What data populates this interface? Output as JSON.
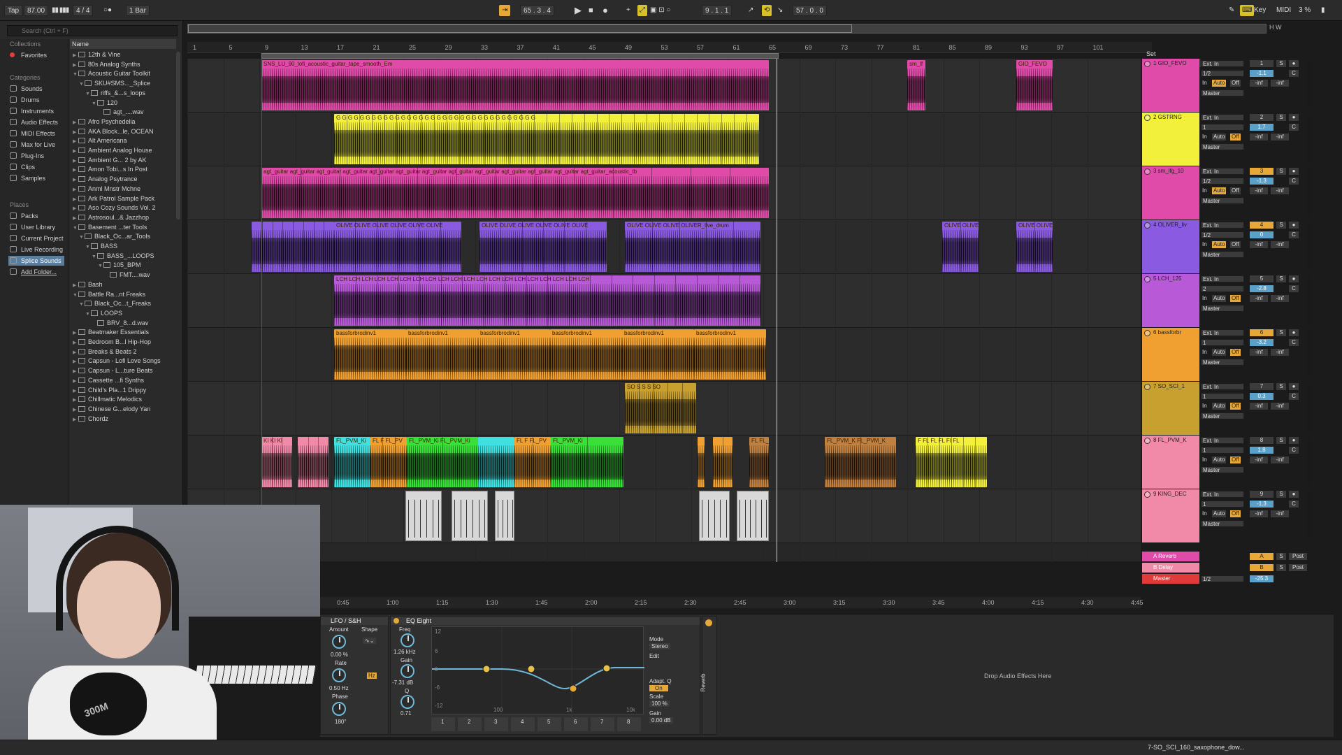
{
  "transport": {
    "tap": "Tap",
    "tempo": "87.00",
    "signature": "4 / 4",
    "quantize": "1 Bar",
    "position": "65 . 3 . 4",
    "loop_start": "9 . 1 . 1",
    "loop_length": "57 . 0 . 0",
    "key": "Key",
    "midi": "MIDI",
    "cpu": "3 %"
  },
  "browser": {
    "search_placeholder": "Search (Ctrl + F)",
    "collections_head": "Collections",
    "favorites": "Favorites",
    "categories_head": "Categories",
    "categories": [
      "Sounds",
      "Drums",
      "Instruments",
      "Audio Effects",
      "MIDI Effects",
      "Max for Live",
      "Plug-Ins",
      "Clips",
      "Samples"
    ],
    "places_head": "Places",
    "places": [
      "Packs",
      "User Library",
      "Current Project",
      "Live Recording",
      "Splice Sounds",
      "Add Folder..."
    ],
    "name_head": "Name",
    "rows": [
      {
        "label": "12th & Vine",
        "indent": 0,
        "tri": "▶"
      },
      {
        "label": "80s Analog Synths",
        "indent": 0,
        "tri": "▶"
      },
      {
        "label": "Acoustic Guitar Toolkit",
        "indent": 0,
        "tri": "▼"
      },
      {
        "label": "SKU#SMS..._Splice",
        "indent": 1,
        "tri": "▼"
      },
      {
        "label": "riffs_&...s_loops",
        "indent": 2,
        "tri": "▼"
      },
      {
        "label": "120",
        "indent": 3,
        "tri": "▼"
      },
      {
        "label": "agt_....wav",
        "indent": 4,
        "tri": ""
      },
      {
        "label": "Afro Psychedelia",
        "indent": 0,
        "tri": "▶"
      },
      {
        "label": "AKA Block...le, OCEAN",
        "indent": 0,
        "tri": "▶"
      },
      {
        "label": "Alt Americana",
        "indent": 0,
        "tri": "▶"
      },
      {
        "label": "Ambient Analog House",
        "indent": 0,
        "tri": "▶"
      },
      {
        "label": "Ambient G... 2 by AK",
        "indent": 0,
        "tri": "▶"
      },
      {
        "label": "Amon Tobi...s In Post",
        "indent": 0,
        "tri": "▶"
      },
      {
        "label": "Analog Psytrance",
        "indent": 0,
        "tri": "▶"
      },
      {
        "label": "Anml Mnstr Mchne",
        "indent": 0,
        "tri": "▶"
      },
      {
        "label": "Ark Patrol Sample Pack",
        "indent": 0,
        "tri": "▶"
      },
      {
        "label": "Aso Cozy Sounds Vol. 2",
        "indent": 0,
        "tri": "▶"
      },
      {
        "label": "Astrosoul...& Jazzhop",
        "indent": 0,
        "tri": "▶"
      },
      {
        "label": "Basement ...ter Tools",
        "indent": 0,
        "tri": "▼"
      },
      {
        "label": "Black_Oc...ar_Tools",
        "indent": 1,
        "tri": "▼"
      },
      {
        "label": "BASS",
        "indent": 2,
        "tri": "▼"
      },
      {
        "label": "BASS_...LOOPS",
        "indent": 3,
        "tri": "▼"
      },
      {
        "label": "105_BPM",
        "indent": 4,
        "tri": "▼"
      },
      {
        "label": "FMT....wav",
        "indent": 5,
        "tri": ""
      },
      {
        "label": "Bash",
        "indent": 0,
        "tri": "▶"
      },
      {
        "label": "Battle Ra...nt Freaks",
        "indent": 0,
        "tri": "▼"
      },
      {
        "label": "Black_Oc...t_Freaks",
        "indent": 1,
        "tri": "▼"
      },
      {
        "label": "LOOPS",
        "indent": 2,
        "tri": "▼"
      },
      {
        "label": "BRV_8...d.wav",
        "indent": 3,
        "tri": ""
      },
      {
        "label": "Beatmaker Essentials",
        "indent": 0,
        "tri": "▶"
      },
      {
        "label": "Bedroom B...l Hip-Hop",
        "indent": 0,
        "tri": "▶"
      },
      {
        "label": "Breaks & Beats 2",
        "indent": 0,
        "tri": "▶"
      },
      {
        "label": "Capsun - Lofi Love Songs",
        "indent": 0,
        "tri": "▶"
      },
      {
        "label": "Capsun - L...ture Beats",
        "indent": 0,
        "tri": "▶"
      },
      {
        "label": "Cassette ...fi Synths",
        "indent": 0,
        "tri": "▶"
      },
      {
        "label": "Child's Pla...1 Drippy",
        "indent": 0,
        "tri": "▶"
      },
      {
        "label": "Chillmatic Melodics",
        "indent": 0,
        "tri": "▶"
      },
      {
        "label": "Chinese G...elody Yan",
        "indent": 0,
        "tri": "▶"
      },
      {
        "label": "Chordz",
        "indent": 0,
        "tri": "▶"
      }
    ]
  },
  "ruler": {
    "bars": [
      "1",
      "5",
      "9",
      "13",
      "17",
      "21",
      "25",
      "29",
      "33",
      "37",
      "41",
      "45",
      "49",
      "53",
      "57",
      "61",
      "65",
      "69",
      "73",
      "77",
      "81",
      "85",
      "89",
      "93",
      "97",
      "101"
    ],
    "set_label": "Set"
  },
  "time_ruler": [
    "0:45",
    "1:00",
    "1:15",
    "1:30",
    "1:45",
    "2:00",
    "2:15",
    "2:30",
    "2:45",
    "3:00",
    "3:15",
    "3:30",
    "3:45",
    "4:00",
    "4:15",
    "4:30",
    "4:45"
  ],
  "tracks": [
    {
      "num": "1",
      "name": "1 GIO_FEVO",
      "color": "#e04aa8",
      "routing": "Ext. In",
      "chan": "1/2",
      "vol": "-1.1",
      "pan": "C",
      "auto_on": true
    },
    {
      "num": "2",
      "name": "2 GSTRNG",
      "color": "#f2f03a",
      "routing": "Ext. In",
      "chan": "1",
      "vol": "1.7",
      "pan": "C",
      "auto_on": false
    },
    {
      "num": "3",
      "name": "3 sm_lfg_10",
      "color": "#e04aa8",
      "routing": "Ext. In",
      "chan": "1/2",
      "vol": "-1.3",
      "pan": "C",
      "auto_on": true
    },
    {
      "num": "4",
      "name": "4 OLIVER_liv",
      "color": "#8a5ae0",
      "routing": "Ext. In",
      "chan": "1/2",
      "vol": "0",
      "pan": "C",
      "auto_on": true
    },
    {
      "num": "5",
      "name": "5 LCH_125",
      "color": "#b85ad8",
      "routing": "Ext. In",
      "chan": "2",
      "vol": "-2.8",
      "pan": "C",
      "auto_on": false
    },
    {
      "num": "6",
      "name": "6 bassforbr",
      "color": "#f0a030",
      "routing": "Ext. In",
      "chan": "1",
      "vol": "-3.2",
      "pan": "C",
      "auto_on": false
    },
    {
      "num": "7",
      "name": "7 SO_SCI_1",
      "color": "#c8a030",
      "routing": "Ext. In",
      "chan": "1",
      "vol": "0.3",
      "pan": "C",
      "auto_on": false
    },
    {
      "num": "8",
      "name": "8 FL_PVM_K",
      "color": "#f08aa8",
      "routing": "Ext. In",
      "chan": "1",
      "vol": "1.8",
      "pan": "C",
      "auto_on": false
    },
    {
      "num": "9",
      "name": "9 KING_DEC",
      "color": "#f08aa8",
      "routing": "Ext. In",
      "chan": "1",
      "vol": "-1.3",
      "pan": "C",
      "auto_on": false
    }
  ],
  "returns": [
    {
      "name": "A Reverb",
      "letter": "A",
      "color": "#e04aa8",
      "post": "Post"
    },
    {
      "name": "B Delay",
      "letter": "B",
      "color": "#f08aa8",
      "post": "Post"
    },
    {
      "name": "Master",
      "letter": "",
      "color": "#e03a3a",
      "post": "",
      "chan": "1/2",
      "vol": "-25.3"
    }
  ],
  "labels": {
    "in": "In",
    "auto": "Auto",
    "off": "Off",
    "master": "Master",
    "inf": "-inf",
    "s": "S",
    "ext_in": "Ext. In"
  },
  "clips": {
    "t1": [
      "SNS_LU_90_lofi_acoustic_guitar_tape_smooth_Em",
      "sm_lf",
      "GIO_FEVO"
    ],
    "t2": "G G G G G G G G G G G G G G G G G G G G G G G G G G G G G G G G G G",
    "t3": "agt_guitar  agt_guitar  agt_guitar  agt_guitar  agt_guitar  agt_guitar  agt_guitar  agt_guitar  agt_guitar  agt_guitar  agt_guitar  agt_guitar  agt_guitar_acoustic_tb",
    "t4": [
      "OLIVE OLIVE OLIVE OLIVE OLIVE OLIVE",
      "OLIVE OLIVE OLIVE OLIVE OLIVE OLIVE",
      "OLIVE OLIVE OLIVE OLIVER_live_drum",
      "OLIVE OLIVE",
      "OLIVE OLIVE"
    ],
    "t5": "LCH  LCH  LCH  LCH  LCH  LCH  LCH  LCH  LCH  LCH  LCH  LCH  LCH  LCH  LCH  LCH  LCH  LCH  LCH  LCH",
    "t6": [
      "bassforbrodinv1",
      "bassforbrodinv1",
      "bassforbrodinv1",
      "bassforbrodinv1",
      "bassforbrodinv1",
      "bassforbrodinv1"
    ],
    "t7": "SO S S S SO",
    "t8": [
      "KI KI KI",
      "FL_PVM_Ki",
      "FL F FL_PV",
      "FL_PVM_Ki FL_PVM_Ki",
      "FL F FL_PV",
      "FL_PVM_Ki",
      "FL FL_PV",
      "FL_PVM_K FL_PVM_K",
      "F FL FL FL FI FL"
    ]
  },
  "devices": {
    "lfo_title": "LFO / S&H",
    "amount_label": "Amount",
    "shape_label": "Shape",
    "amount_value": "0.00 %",
    "rate_label": "Rate",
    "rate_value": "0.50 Hz",
    "phase_label": "Phase",
    "phase_value": "180°",
    "hz": "Hz",
    "eq_title": "EQ Eight",
    "freq_label": "Freq",
    "freq_value": "1.26 kHz",
    "gain_label": "Gain",
    "gain_value": "-7.31 dB",
    "q_label": "Q",
    "q_value": "0.71",
    "mode_label": "Mode",
    "mode_value": "Stereo",
    "edit_label": "Edit",
    "adapt_label": "Adapt. Q",
    "adapt_value": "On",
    "scale_label": "Scale",
    "scale_value": "100 %",
    "out_gain_label": "Gain",
    "out_gain_value": "0.00 dB",
    "eq_axis": [
      "12",
      "6",
      "0",
      "-6",
      "-12"
    ],
    "eq_freq_axis": [
      "100",
      "1k",
      "10k"
    ],
    "band_nums": [
      "1",
      "2",
      "3",
      "4",
      "5",
      "6",
      "7",
      "8"
    ],
    "reverb_tab": "Reverb",
    "drop_zone": "Drop Audio Effects Here"
  },
  "status": {
    "text": "7-SO_SCI_160_saxophone_dow..."
  },
  "webcam": {
    "mic_text": "300M"
  },
  "colors": {
    "pink": "#e04aa8",
    "yellow": "#f2f03a",
    "purple": "#8a5ae0",
    "violet": "#b85ad8",
    "orange": "#f0a030",
    "gold": "#c8a030",
    "salmon": "#f08aa8",
    "cyan": "#40e0e0",
    "green": "#38e038",
    "brown": "#c08040"
  }
}
